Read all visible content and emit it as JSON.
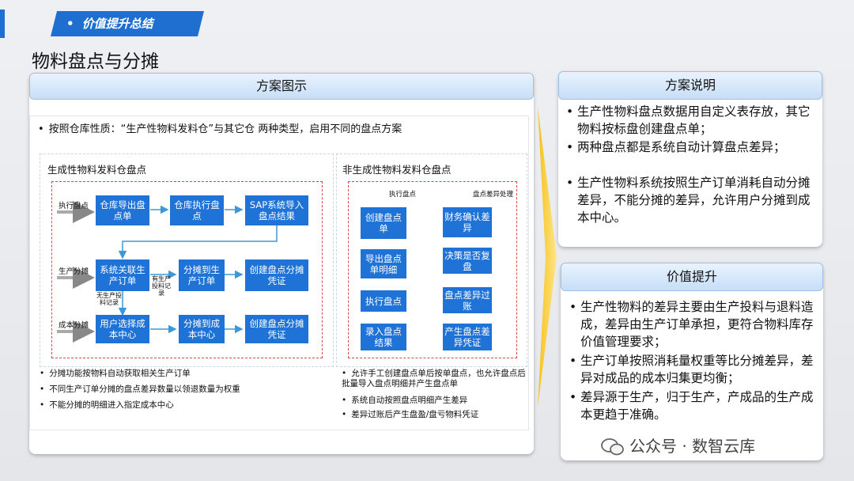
{
  "header": {
    "tag": "价值提升总结",
    "bullet": "•"
  },
  "page_title": "物料盘点与分摊",
  "left": {
    "heading": "方案图示",
    "intro": "按照仓库性质：“生产性物料发料仓”与其它仓 两种类型，启用不同的盘点方案",
    "production": {
      "title": "生成性物料发料仓盘点",
      "row_labels": [
        "执行盘点",
        "生产分摊",
        "成本分摊"
      ],
      "boxes": [
        "仓库导出盘点单",
        "仓库执行盘点",
        "SAP系统导入盘点结果",
        "系统关联生产订单",
        "分摊到生产订单",
        "创建盘点分摊凭证",
        "用户选择成本中心",
        "分摊到成本中心",
        "创建盘点分摊凭证"
      ],
      "side_notes": {
        "no_record": "无生产投料记录",
        "has_record": "有生产投料记录"
      },
      "notes": [
        "分摊功能按物料自动获取相关生产订单",
        "不同生产订单分摊的盘点差异数量以领退数量为权重",
        "不能分摊的明细进入指定成本中心"
      ]
    },
    "non_production": {
      "title": "非生成性物料发料仓盘点",
      "col_labels": [
        "执行盘点",
        "盘点差异处理"
      ],
      "boxes_left": [
        "创建盘点单",
        "导出盘点单明细",
        "执行盘点",
        "录入盘点结果"
      ],
      "boxes_right": [
        "财务确认差异",
        "决策是否复盘",
        "盘点差异过账",
        "产生盘点差异凭证"
      ],
      "notes": [
        "允许手工创建盘点单后按单盘点，也允许盘点后批量导入盘点明细并产生盘点单",
        "系统自动按照盘点明细产生差异",
        "差异过账后产生盘盈/盘亏物料凭证"
      ]
    }
  },
  "right_top": {
    "heading": "方案说明",
    "bullets": [
      "生产性物料盘点数据用自定义表存放，其它物料按标盘创建盘点单；",
      "两种盘点都是系统自动计算盘点差异；",
      "生产性物料系统按照生产订单消耗自动分摊差异，不能分摊的差异，允许用户分摊到成本中心。"
    ]
  },
  "right_bottom": {
    "heading": "价值提升",
    "bullets": [
      "生产性物料的差异主要由生产投料与退料造成，差异由生产订单承担，更符合物料库存价值管理要求；",
      "生产订单按照消耗量权重等比分摊差异，差异对成品的成本归集更均衡；",
      "差异源于生产，归于生产，产成品的生产成本更趋于准确。"
    ]
  },
  "watermark": "公众号 · 数智云库",
  "colors": {
    "accent": "#1f73d6",
    "dashed_border": "#d84a4a",
    "chevron": "#f0b400"
  }
}
